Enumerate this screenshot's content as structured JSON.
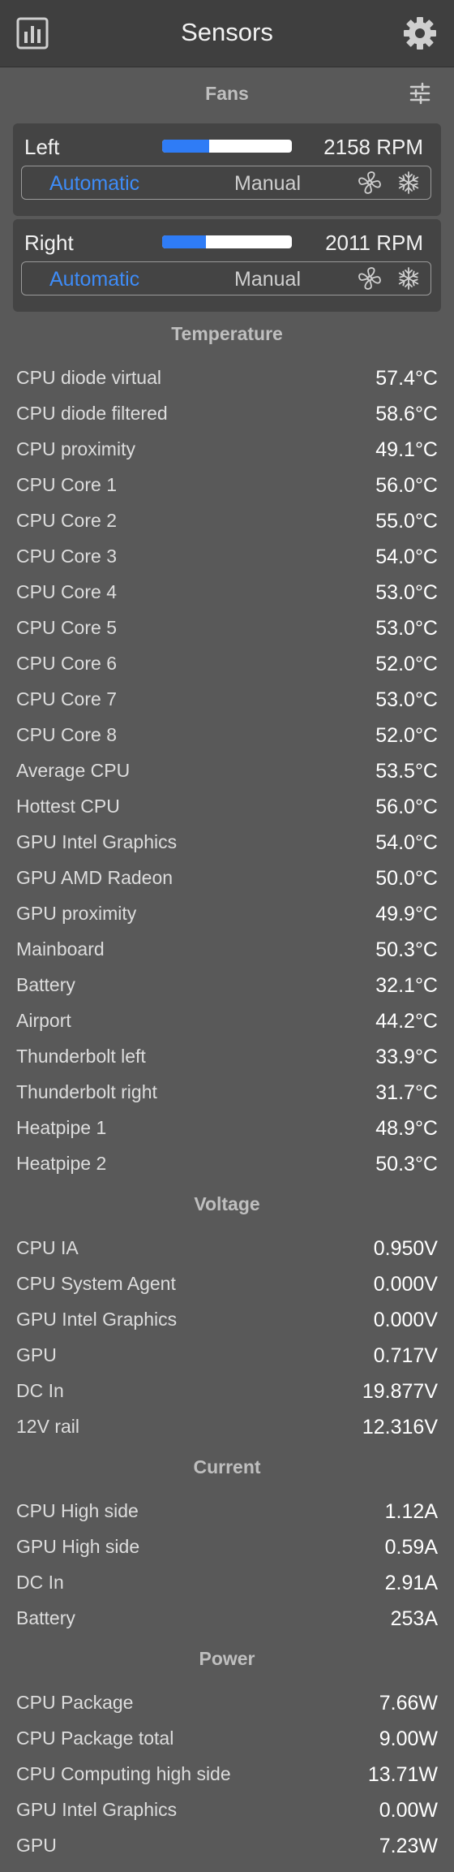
{
  "window": {
    "title": "Sensors"
  },
  "icons": {
    "left": "bar-chart-icon",
    "right": "gear-icon",
    "fans_settings": "sliders-icon"
  },
  "colors": {
    "accent": "#2f7cf6",
    "panel": "#595959",
    "titlebar": "#3f3f3f"
  },
  "fans": {
    "header": "Fans",
    "items": [
      {
        "name": "Left",
        "rpm": "2158 RPM",
        "level_fraction": 0.36,
        "mode_auto": "Automatic",
        "mode_manual": "Manual",
        "selected_mode": "Automatic"
      },
      {
        "name": "Right",
        "rpm": "2011 RPM",
        "level_fraction": 0.34,
        "mode_auto": "Automatic",
        "mode_manual": "Manual",
        "selected_mode": "Automatic"
      }
    ]
  },
  "temperature": {
    "header": "Temperature",
    "rows": [
      {
        "label": "CPU diode virtual",
        "value": "57.4°C"
      },
      {
        "label": "CPU diode filtered",
        "value": "58.6°C"
      },
      {
        "label": "CPU proximity",
        "value": "49.1°C"
      },
      {
        "label": "CPU Core 1",
        "value": "56.0°C"
      },
      {
        "label": "CPU Core 2",
        "value": "55.0°C"
      },
      {
        "label": "CPU Core 3",
        "value": "54.0°C"
      },
      {
        "label": "CPU Core 4",
        "value": "53.0°C"
      },
      {
        "label": "CPU Core 5",
        "value": "53.0°C"
      },
      {
        "label": "CPU Core 6",
        "value": "52.0°C"
      },
      {
        "label": "CPU Core 7",
        "value": "53.0°C"
      },
      {
        "label": "CPU Core 8",
        "value": "52.0°C"
      },
      {
        "label": "Average CPU",
        "value": "53.5°C"
      },
      {
        "label": "Hottest CPU",
        "value": "56.0°C"
      },
      {
        "label": "GPU Intel Graphics",
        "value": "54.0°C"
      },
      {
        "label": "GPU AMD Radeon",
        "value": "50.0°C"
      },
      {
        "label": "GPU proximity",
        "value": "49.9°C"
      },
      {
        "label": "Mainboard",
        "value": "50.3°C"
      },
      {
        "label": "Battery",
        "value": "32.1°C"
      },
      {
        "label": "Airport",
        "value": "44.2°C"
      },
      {
        "label": "Thunderbolt left",
        "value": "33.9°C"
      },
      {
        "label": "Thunderbolt right",
        "value": "31.7°C"
      },
      {
        "label": "Heatpipe 1",
        "value": "48.9°C"
      },
      {
        "label": "Heatpipe 2",
        "value": "50.3°C"
      }
    ]
  },
  "voltage": {
    "header": "Voltage",
    "rows": [
      {
        "label": "CPU IA",
        "value": "0.950V"
      },
      {
        "label": "CPU System Agent",
        "value": "0.000V"
      },
      {
        "label": "GPU Intel Graphics",
        "value": "0.000V"
      },
      {
        "label": "GPU",
        "value": "0.717V"
      },
      {
        "label": "DC In",
        "value": "19.877V"
      },
      {
        "label": "12V rail",
        "value": "12.316V"
      }
    ]
  },
  "current": {
    "header": "Current",
    "rows": [
      {
        "label": "CPU High side",
        "value": "1.12A"
      },
      {
        "label": "GPU High side",
        "value": "0.59A"
      },
      {
        "label": "DC In",
        "value": "2.91A"
      },
      {
        "label": "Battery",
        "value": "253A"
      }
    ]
  },
  "power": {
    "header": "Power",
    "rows": [
      {
        "label": "CPU Package",
        "value": "7.66W"
      },
      {
        "label": "CPU Package total",
        "value": "9.00W"
      },
      {
        "label": "CPU Computing high side",
        "value": "13.71W"
      },
      {
        "label": "GPU Intel Graphics",
        "value": "0.00W"
      },
      {
        "label": "GPU",
        "value": "7.23W"
      }
    ]
  }
}
